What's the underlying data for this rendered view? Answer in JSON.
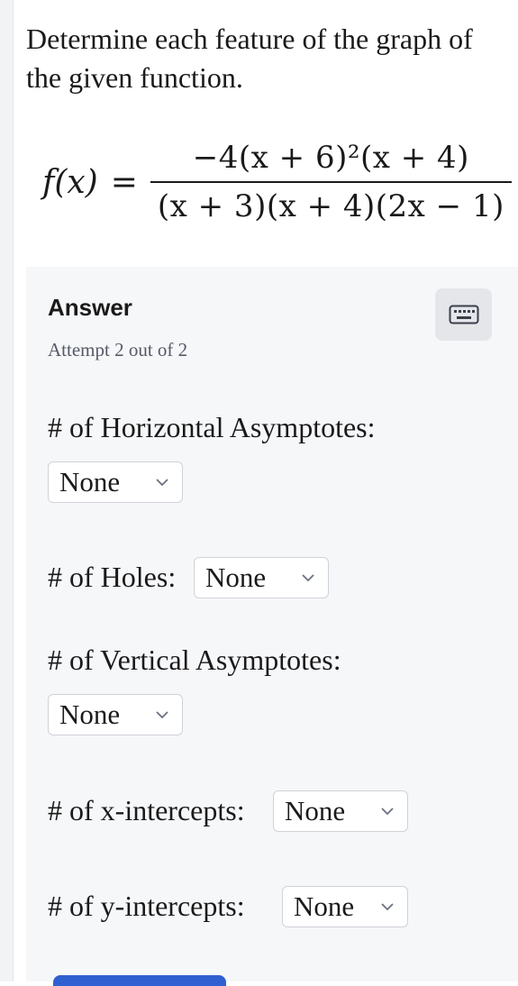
{
  "question": {
    "prompt": "Determine each feature of the graph of the given function.",
    "function_lhs": "f(x)",
    "function_equals": "=",
    "numerator": "−4(x + 6)²(x + 4)",
    "denominator": "(x + 3)(x + 4)(2x − 1)"
  },
  "answer": {
    "title": "Answer",
    "attempt_text": "Attempt 2 out of 2",
    "keyboard_icon": "keyboard-icon",
    "fields": [
      {
        "label": "# of Horizontal Asymptotes:",
        "value": "None"
      },
      {
        "label": "# of Holes:",
        "value": "None"
      },
      {
        "label": "# of Vertical Asymptotes:",
        "value": "None"
      },
      {
        "label": "# of x-intercepts:",
        "value": "None"
      },
      {
        "label": "# of y-intercepts:",
        "value": "None"
      }
    ]
  },
  "colors": {
    "panel_bg": "#f6f7f9",
    "submit_button": "#2f5fd0"
  }
}
